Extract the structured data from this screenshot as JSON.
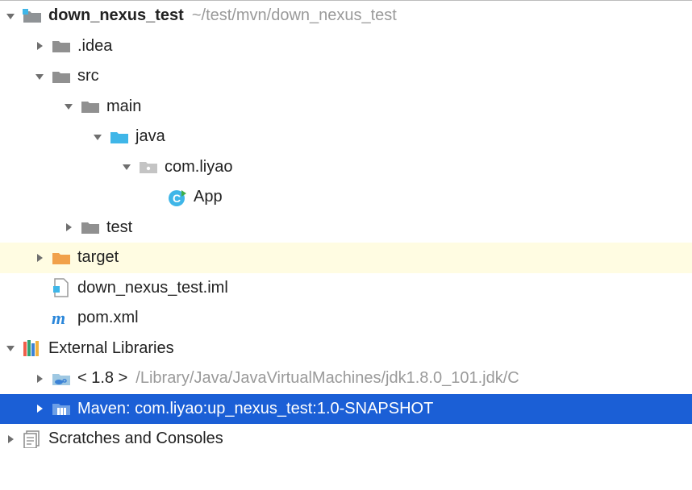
{
  "tree": {
    "root": {
      "name": "down_nexus_test",
      "path": "~/test/mvn/down_nexus_test"
    },
    "idea": ".idea",
    "src": "src",
    "main": "main",
    "java": "java",
    "package": "com.liyao",
    "appClass": "App",
    "testDir": "test",
    "target": "target",
    "iml": "down_nexus_test.iml",
    "pom": "pom.xml",
    "extLibs": "External Libraries",
    "jdk": {
      "label": "< 1.8 >",
      "path": "/Library/Java/JavaVirtualMachines/jdk1.8.0_101.jdk/C"
    },
    "mavenLib": "Maven: com.liyao:up_nexus_test:1.0-SNAPSHOT",
    "scratches": "Scratches and Consoles"
  },
  "colors": {
    "folderGray": "#909090",
    "folderBlue": "#3fb6e8",
    "folderOrange": "#f1a14b",
    "selection": "#1b5fd6",
    "targetBg": "#fffce2"
  }
}
